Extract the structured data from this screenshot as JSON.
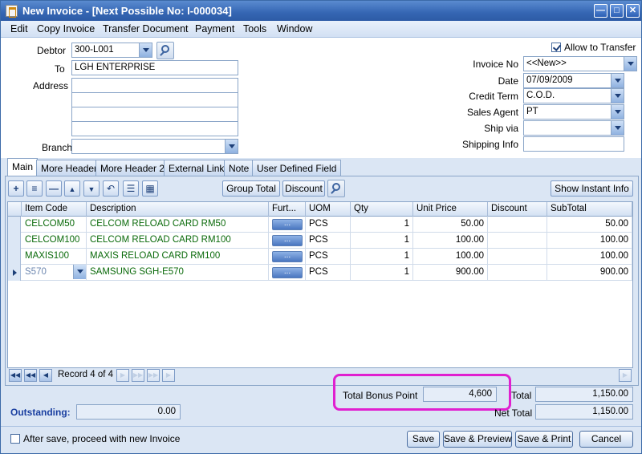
{
  "window": {
    "title": "New Invoice - [Next Possible No: I-000034]"
  },
  "menu": [
    "Edit",
    "Copy Invoice",
    "Transfer Document",
    "Payment",
    "Tools",
    "Window"
  ],
  "header": {
    "allow_transfer_label": "Allow to Transfer",
    "allow_transfer_checked": true,
    "debtor_label": "Debtor",
    "debtor_value": "300-L001",
    "to_label": "To",
    "to_value": "LGH ENTERPRISE",
    "address_label": "Address",
    "address_lines": [
      "",
      "",
      "",
      ""
    ],
    "branch_label": "Branch",
    "branch_value": "",
    "invoice_no_label": "Invoice No",
    "invoice_no_value": "<<New>>",
    "date_label": "Date",
    "date_value": "07/09/2009",
    "credit_term_label": "Credit Term",
    "credit_term_value": "C.O.D.",
    "sales_agent_label": "Sales Agent",
    "sales_agent_value": "PT",
    "ship_via_label": "Ship via",
    "ship_via_value": "",
    "shipping_info_label": "Shipping Info",
    "shipping_info_value": ""
  },
  "tabs": [
    "Main",
    "More Header",
    "More Header 2",
    "External Link",
    "Note",
    "User Defined Field"
  ],
  "toolbar": {
    "group_total_label": "Group Total",
    "discount_label": "Discount",
    "show_instant_info_label": "Show Instant Info"
  },
  "grid": {
    "columns": [
      "Item Code",
      "Description",
      "Furt...",
      "UOM",
      "Qty",
      "Unit Price",
      "Discount",
      "SubTotal"
    ],
    "more_button_label": "...",
    "rows": [
      {
        "item_code": "CELCOM50",
        "description": "CELCOM RELOAD CARD RM50",
        "uom": "PCS",
        "qty": "1",
        "unit_price": "50.00",
        "discount": "",
        "subtotal": "50.00"
      },
      {
        "item_code": "CELCOM100",
        "description": "CELCOM RELOAD CARD RM100",
        "uom": "PCS",
        "qty": "1",
        "unit_price": "100.00",
        "discount": "",
        "subtotal": "100.00"
      },
      {
        "item_code": "MAXIS100",
        "description": "MAXIS RELOAD CARD RM100",
        "uom": "PCS",
        "qty": "1",
        "unit_price": "100.00",
        "discount": "",
        "subtotal": "100.00"
      },
      {
        "item_code": "S570",
        "description": "SAMSUNG SGH-E570",
        "uom": "PCS",
        "qty": "1",
        "unit_price": "900.00",
        "discount": "",
        "subtotal": "900.00"
      }
    ]
  },
  "navigator": {
    "record_text": "Record 4 of 4"
  },
  "totals": {
    "total_bonus_point_label": "Total Bonus Point",
    "total_bonus_point_value": "4,600",
    "total_label": "Total",
    "total_value": "1,150.00",
    "net_total_label": "Net Total",
    "net_total_value": "1,150.00",
    "outstanding_label": "Outstanding:",
    "outstanding_value": "0.00"
  },
  "footer": {
    "after_save_label": "After save, proceed with new Invoice",
    "after_save_checked": false,
    "save_label": "Save",
    "save_preview_label": "Save & Preview",
    "save_print_label": "Save & Print",
    "cancel_label": "Cancel"
  },
  "colors": {
    "title_bar": "#3566b3",
    "highlight_border": "#e020d0",
    "item_text": "#0a6a0a",
    "outstanding_label": "#1a3fa0"
  }
}
